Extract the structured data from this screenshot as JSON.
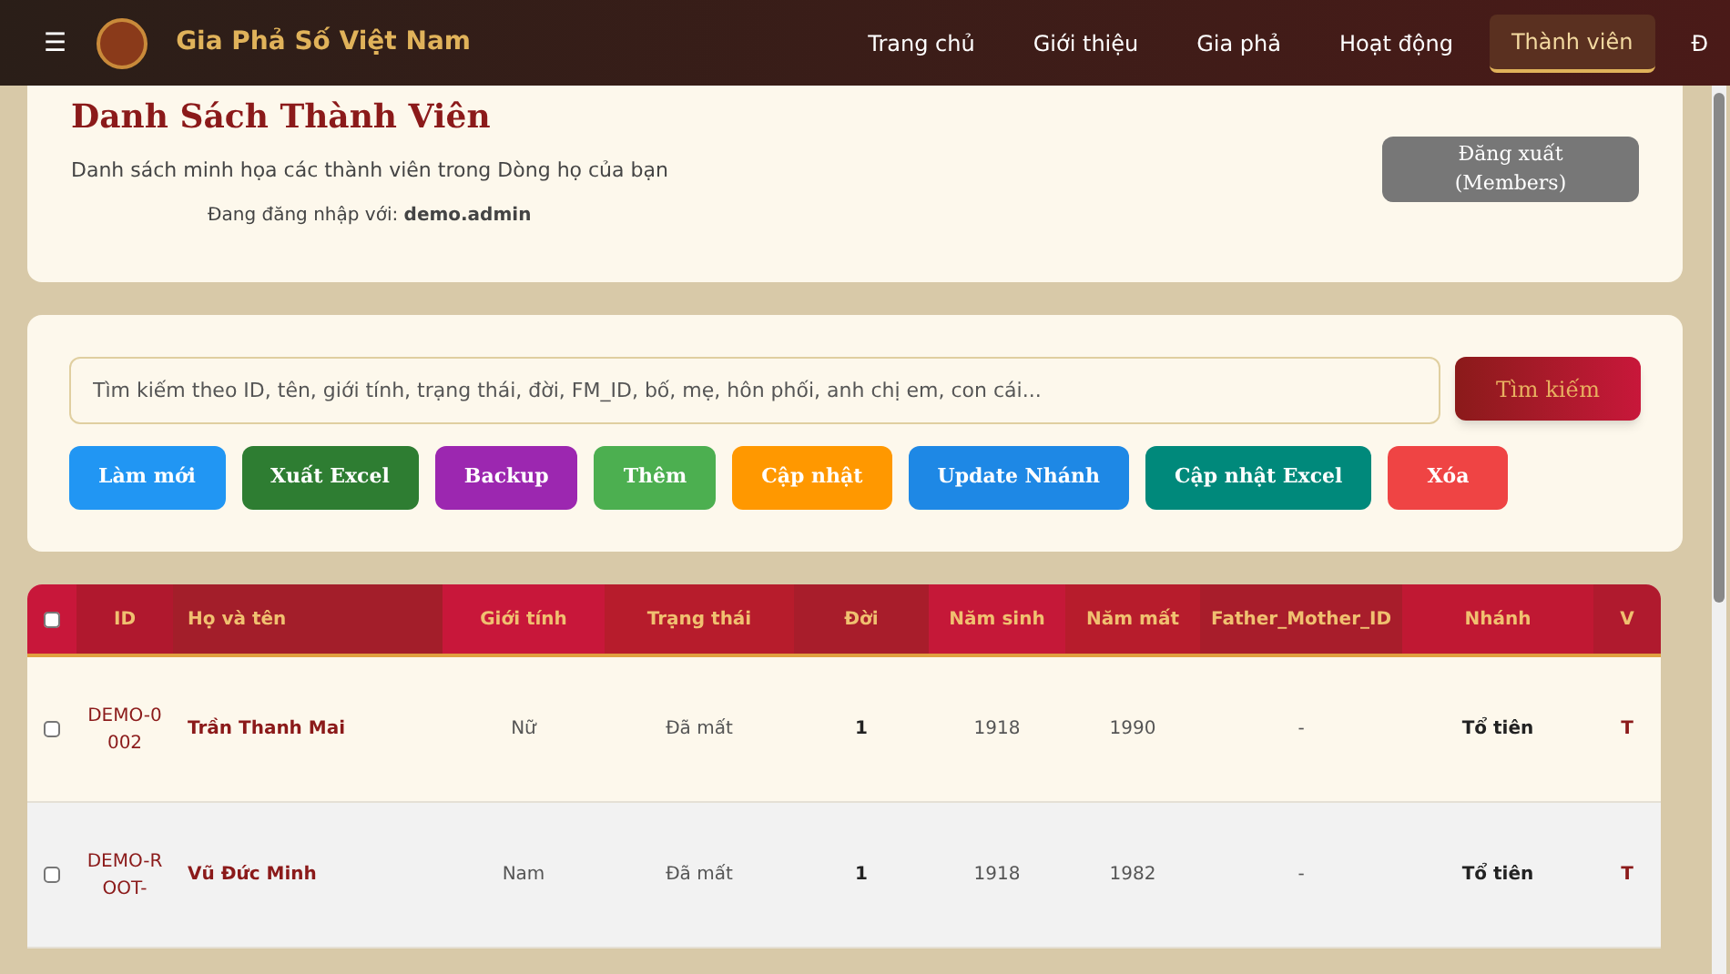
{
  "navbar": {
    "brand": "Gia Phả Số Việt Nam",
    "menu_icon": "☰",
    "items": [
      {
        "label": "Trang chủ",
        "selected": false
      },
      {
        "label": "Giới thiệu",
        "selected": false
      },
      {
        "label": "Gia phả",
        "selected": false
      },
      {
        "label": "Hoạt động",
        "selected": false
      },
      {
        "label": "Thành viên",
        "selected": true
      },
      {
        "label": "Đ",
        "selected": false
      }
    ]
  },
  "header": {
    "title": "Danh Sách Thành Viên",
    "subtitle": "Danh sách minh họa các thành viên trong Dòng họ của bạn",
    "login_label": "Đang đăng nhập với:",
    "login_user": "demo.admin",
    "logout_button": "Đăng xuất (Members)"
  },
  "search": {
    "placeholder": "Tìm kiếm theo ID, tên, giới tính, trạng thái, đời, FM_ID, bố, mẹ, hôn phối, anh chị em, con cái...",
    "button": "Tìm kiếm"
  },
  "actions": [
    {
      "label": "Làm mới",
      "color": "#2196f3"
    },
    {
      "label": "Xuất Excel",
      "color": "#2e7d32"
    },
    {
      "label": "Backup",
      "color": "#9c27b0"
    },
    {
      "label": "Thêm",
      "color": "#4caf50"
    },
    {
      "label": "Cập nhật",
      "color": "#ff9800"
    },
    {
      "label": "Update Nhánh",
      "color": "#1e88e5"
    },
    {
      "label": "Cập nhật Excel",
      "color": "#00897b"
    },
    {
      "label": "Xóa",
      "color": "#ef4444"
    }
  ],
  "table": {
    "select_all": false,
    "columns": [
      "ID",
      "Họ và tên",
      "Giới tính",
      "Trạng thái",
      "Đời",
      "Năm sinh",
      "Năm mất",
      "Father_Mother_ID",
      "Nhánh",
      "V"
    ],
    "rows": [
      {
        "selected": false,
        "id": "DEMO-0002",
        "name": "Trần Thanh Mai",
        "gender": "Nữ",
        "status": "Đã mất",
        "generation": "1",
        "birth": "1918",
        "death": "1990",
        "fm_id": "-",
        "branch": "Tổ tiên",
        "column_10": "T"
      },
      {
        "selected": false,
        "id": "DEMO-ROOT-",
        "name": "Vũ Đức Minh",
        "gender": "Nam",
        "status": "Đã mất",
        "generation": "1",
        "birth": "1918",
        "death": "1982",
        "fm_id": "-",
        "branch": "Tổ tiên",
        "column_10": "T"
      }
    ]
  }
}
